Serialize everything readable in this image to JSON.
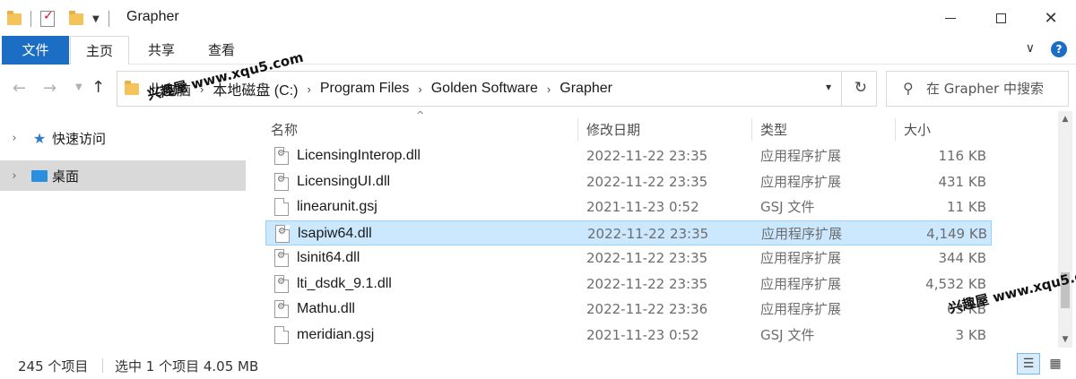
{
  "window": {
    "title": "Grapher",
    "minimize_icon": "minimize-icon",
    "maximize_icon": "maximize-icon",
    "close_icon": "close-icon"
  },
  "ribbon": {
    "tabs": [
      {
        "label": "文件",
        "active": true
      },
      {
        "label": "主页"
      },
      {
        "label": "共享"
      },
      {
        "label": "查看"
      }
    ],
    "expand_glyph": "∨",
    "help_glyph": "?"
  },
  "address": {
    "crumbs": [
      "此电脑",
      "本地磁盘 (C:)",
      "Program Files",
      "Golden Software",
      "Grapher"
    ],
    "separator": "›"
  },
  "search": {
    "placeholder": "在 Grapher 中搜索"
  },
  "nav_pane": {
    "items": [
      {
        "label": "快速访问",
        "icon": "star-icon"
      },
      {
        "label": "桌面",
        "icon": "desktop-icon",
        "selected": true
      }
    ]
  },
  "columns": {
    "name": "名称",
    "date": "修改日期",
    "type": "类型",
    "size": "大小"
  },
  "files": [
    {
      "name": "LicensingInterop.dll",
      "date": "2022-11-22 23:35",
      "type": "应用程序扩展",
      "size": "116 KB",
      "kind": "dll"
    },
    {
      "name": "LicensingUI.dll",
      "date": "2022-11-22 23:35",
      "type": "应用程序扩展",
      "size": "431 KB",
      "kind": "dll"
    },
    {
      "name": "linearunit.gsj",
      "date": "2021-11-23 0:52",
      "type": "GSJ 文件",
      "size": "11 KB",
      "kind": "file"
    },
    {
      "name": "lsapiw64.dll",
      "date": "2022-11-22 23:35",
      "type": "应用程序扩展",
      "size": "4,149 KB",
      "kind": "dll",
      "selected": true
    },
    {
      "name": "lsinit64.dll",
      "date": "2022-11-22 23:35",
      "type": "应用程序扩展",
      "size": "344 KB",
      "kind": "dll"
    },
    {
      "name": "lti_dsdk_9.1.dll",
      "date": "2022-11-22 23:35",
      "type": "应用程序扩展",
      "size": "4,532 KB",
      "kind": "dll"
    },
    {
      "name": "Mathu.dll",
      "date": "2022-11-22 23:36",
      "type": "应用程序扩展",
      "size": "63 KB",
      "kind": "dll"
    },
    {
      "name": "meridian.gsj",
      "date": "2021-11-23 0:52",
      "type": "GSJ 文件",
      "size": "3 KB",
      "kind": "file"
    }
  ],
  "status": {
    "count": "245 个项目",
    "selection": "选中 1 个项目  4.05 MB"
  },
  "watermark": {
    "text": "兴趣屋 www.xqu5.com"
  },
  "colors": {
    "accent": "#1c6ec5",
    "selection": "#cce8ff",
    "selection_border": "#99d1ff"
  }
}
